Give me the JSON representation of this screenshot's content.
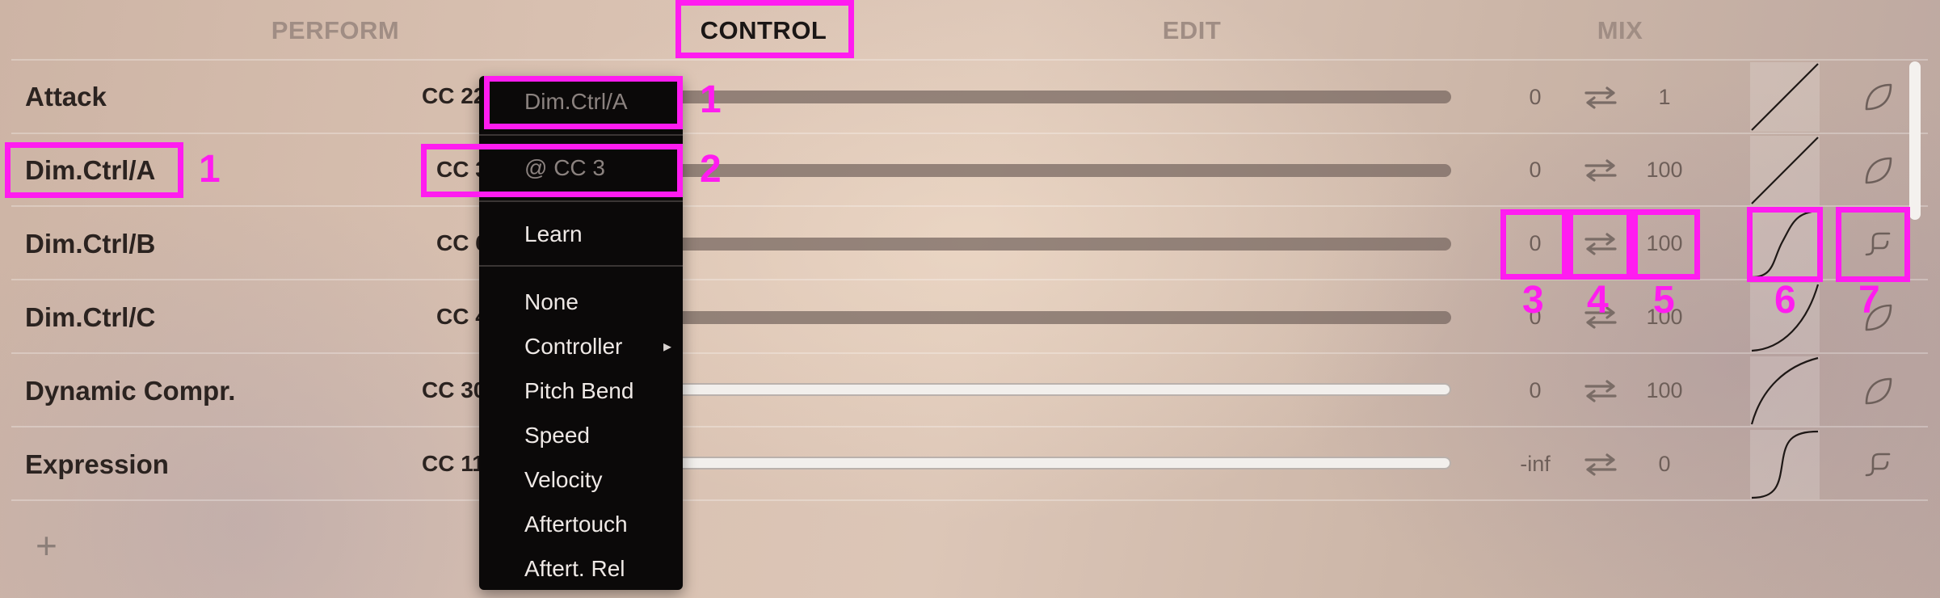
{
  "tabs": [
    "PERFORM",
    "CONTROL",
    "EDIT",
    "MIX"
  ],
  "active_tab": "CONTROL",
  "rows": [
    {
      "name": "Attack",
      "cc": "CC 22",
      "min": "0",
      "max": "1",
      "curve": "linear",
      "shape": "leaf-icon"
    },
    {
      "name": "Dim.Ctrl/A",
      "cc": "CC 3",
      "min": "0",
      "max": "100",
      "curve": "linear",
      "shape": "leaf-icon"
    },
    {
      "name": "Dim.Ctrl/B",
      "cc": "CC 6",
      "min": "0",
      "max": "100",
      "curve": "s-curve",
      "shape": "step-icon"
    },
    {
      "name": "Dim.Ctrl/C",
      "cc": "CC 4",
      "min": "0",
      "max": "100",
      "curve": "exponential",
      "shape": "leaf-icon"
    },
    {
      "name": "Dynamic Compr.",
      "cc": "CC 30",
      "min": "0",
      "max": "100",
      "curve": "logarithmic",
      "shape": "leaf-icon"
    },
    {
      "name": "Expression",
      "cc": "CC 11",
      "min": "-inf",
      "max": "0",
      "curve": "s-curve",
      "shape": "step-icon"
    }
  ],
  "add_label": "+",
  "menu": {
    "header_name": "Dim.Ctrl/A",
    "header_cc": "@ CC 3",
    "learn": "Learn",
    "items": [
      "None",
      "Controller",
      "Pitch Bend",
      "Speed",
      "Velocity",
      "Aftertouch",
      "Aftert. Rel"
    ],
    "submenu_arrow": "▸"
  },
  "annotations": [
    "1",
    "1",
    "2",
    "3",
    "4",
    "5",
    "6",
    "7"
  ],
  "colors": {
    "highlight": "#ff1cf0",
    "menu_bg": "#0b0909",
    "text": "#2b2320"
  }
}
